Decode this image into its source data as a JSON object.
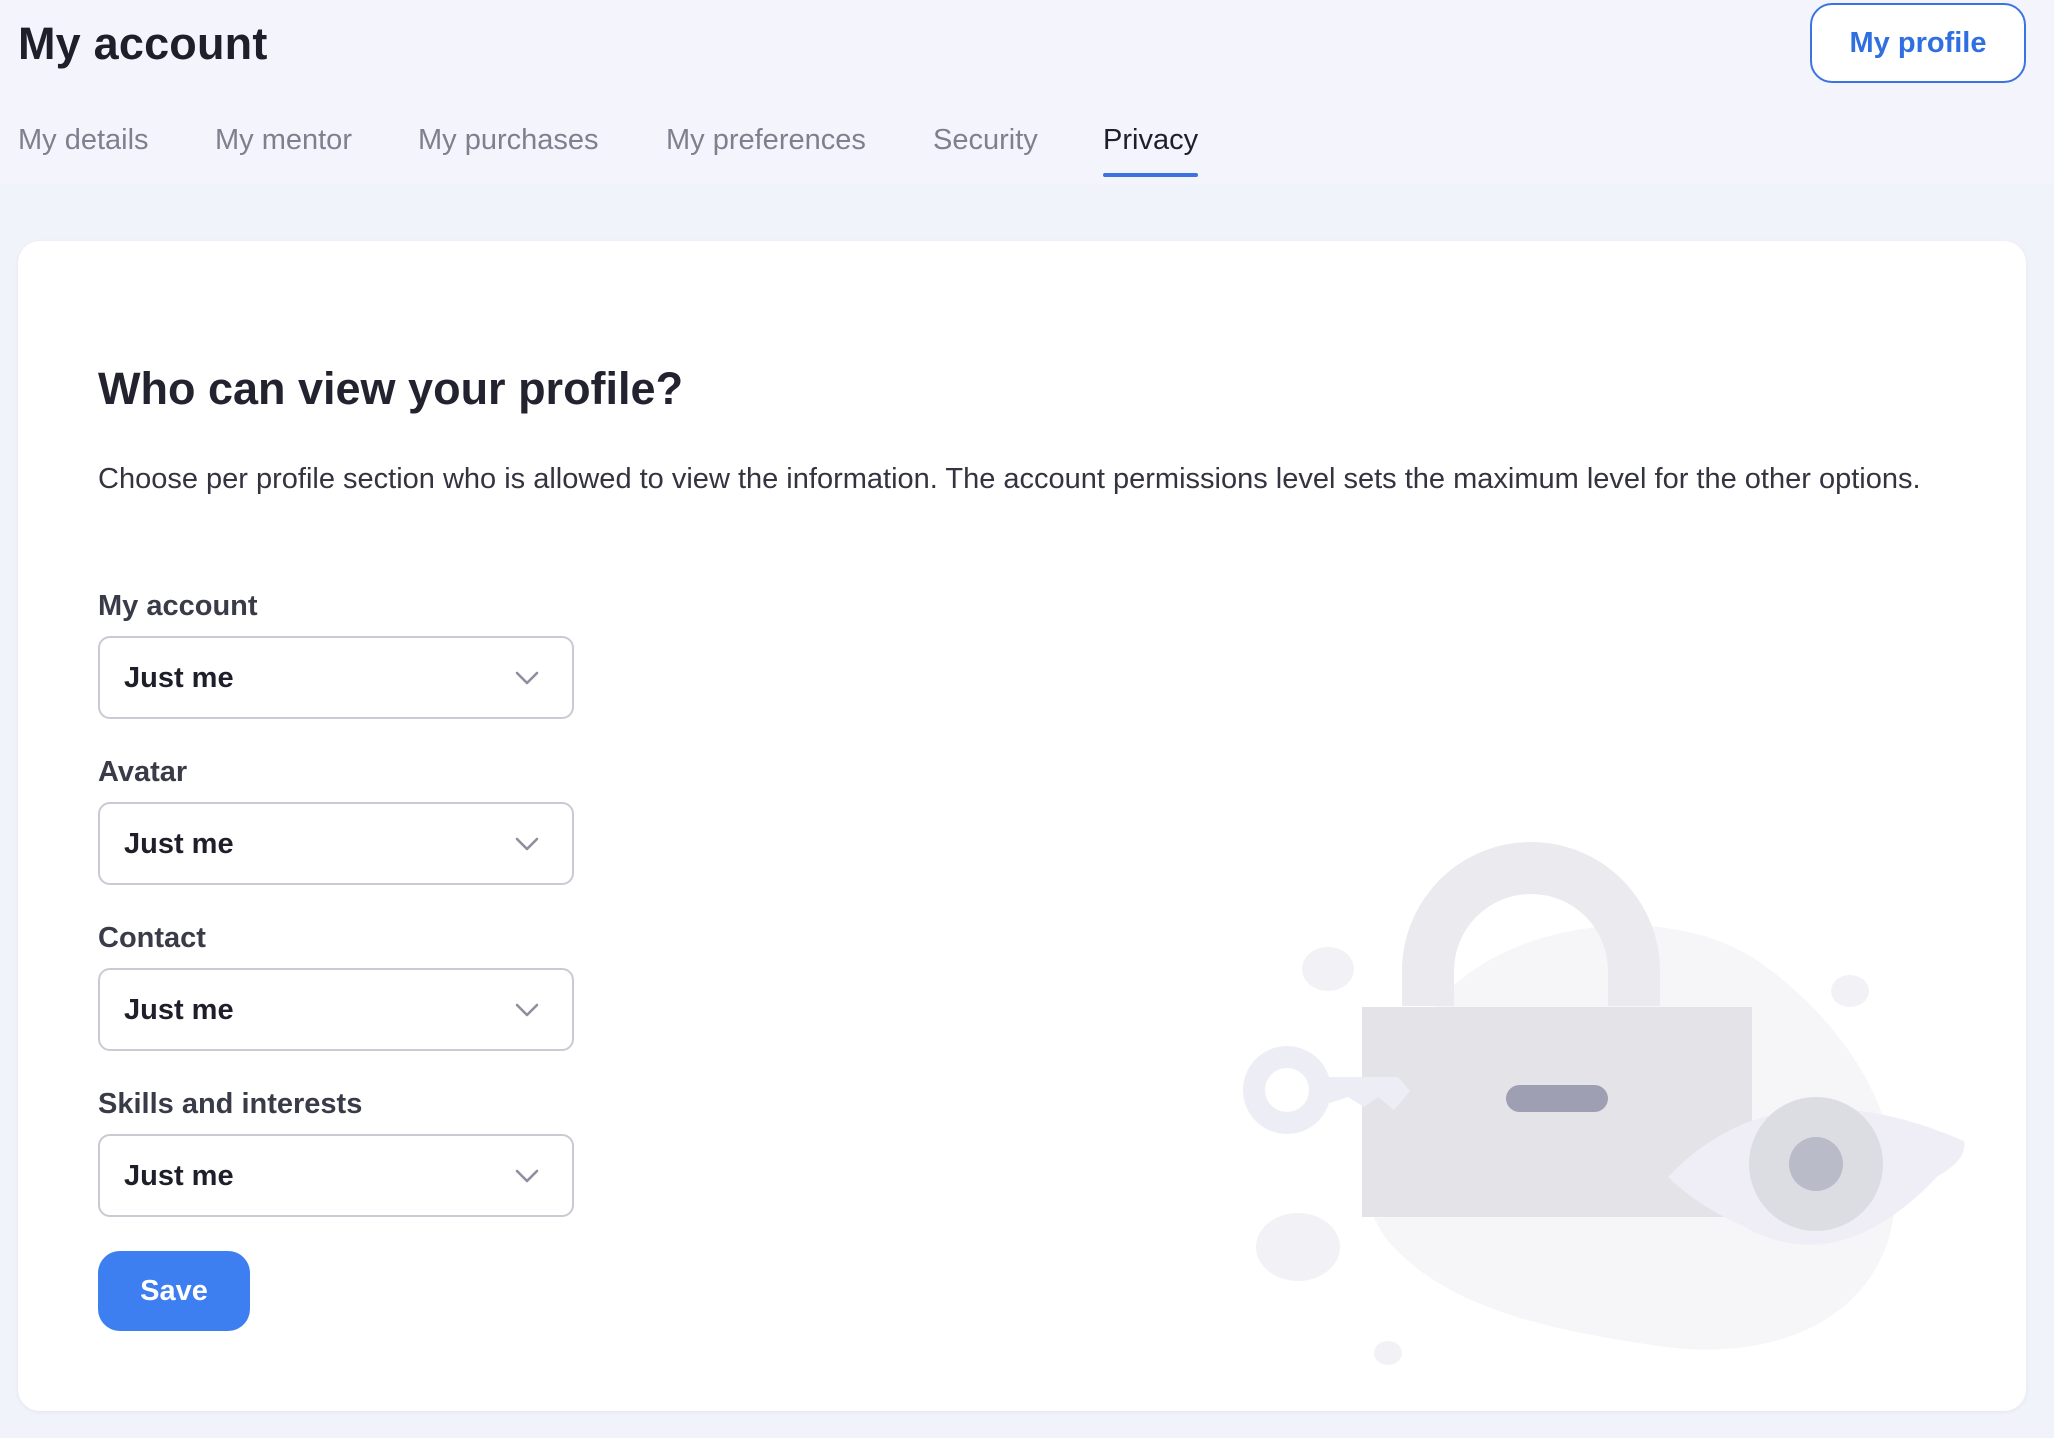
{
  "header": {
    "title": "My account",
    "profile_button": "My profile"
  },
  "tabs": [
    {
      "label": "My details",
      "active": false
    },
    {
      "label": "My mentor",
      "active": false
    },
    {
      "label": "My purchases",
      "active": false
    },
    {
      "label": "My preferences",
      "active": false
    },
    {
      "label": "Security",
      "active": false
    },
    {
      "label": "Privacy",
      "active": true
    }
  ],
  "privacy": {
    "title": "Who can view your profile?",
    "description": "Choose per profile section who is allowed to view the information. The account permissions level sets the maximum level for the other options.",
    "fields": [
      {
        "label": "My account",
        "value": "Just me"
      },
      {
        "label": "Avatar",
        "value": "Just me"
      },
      {
        "label": "Contact",
        "value": "Just me"
      },
      {
        "label": "Skills and interests",
        "value": "Just me"
      }
    ],
    "save_label": "Save"
  },
  "colors": {
    "accent": "#3d7ef0",
    "tab_underline": "#3a73df",
    "background": "#f1f3fb"
  },
  "icons": {
    "select_indicator": "chevron-down-icon",
    "illustration": "padlock-key-eye-illustration"
  }
}
